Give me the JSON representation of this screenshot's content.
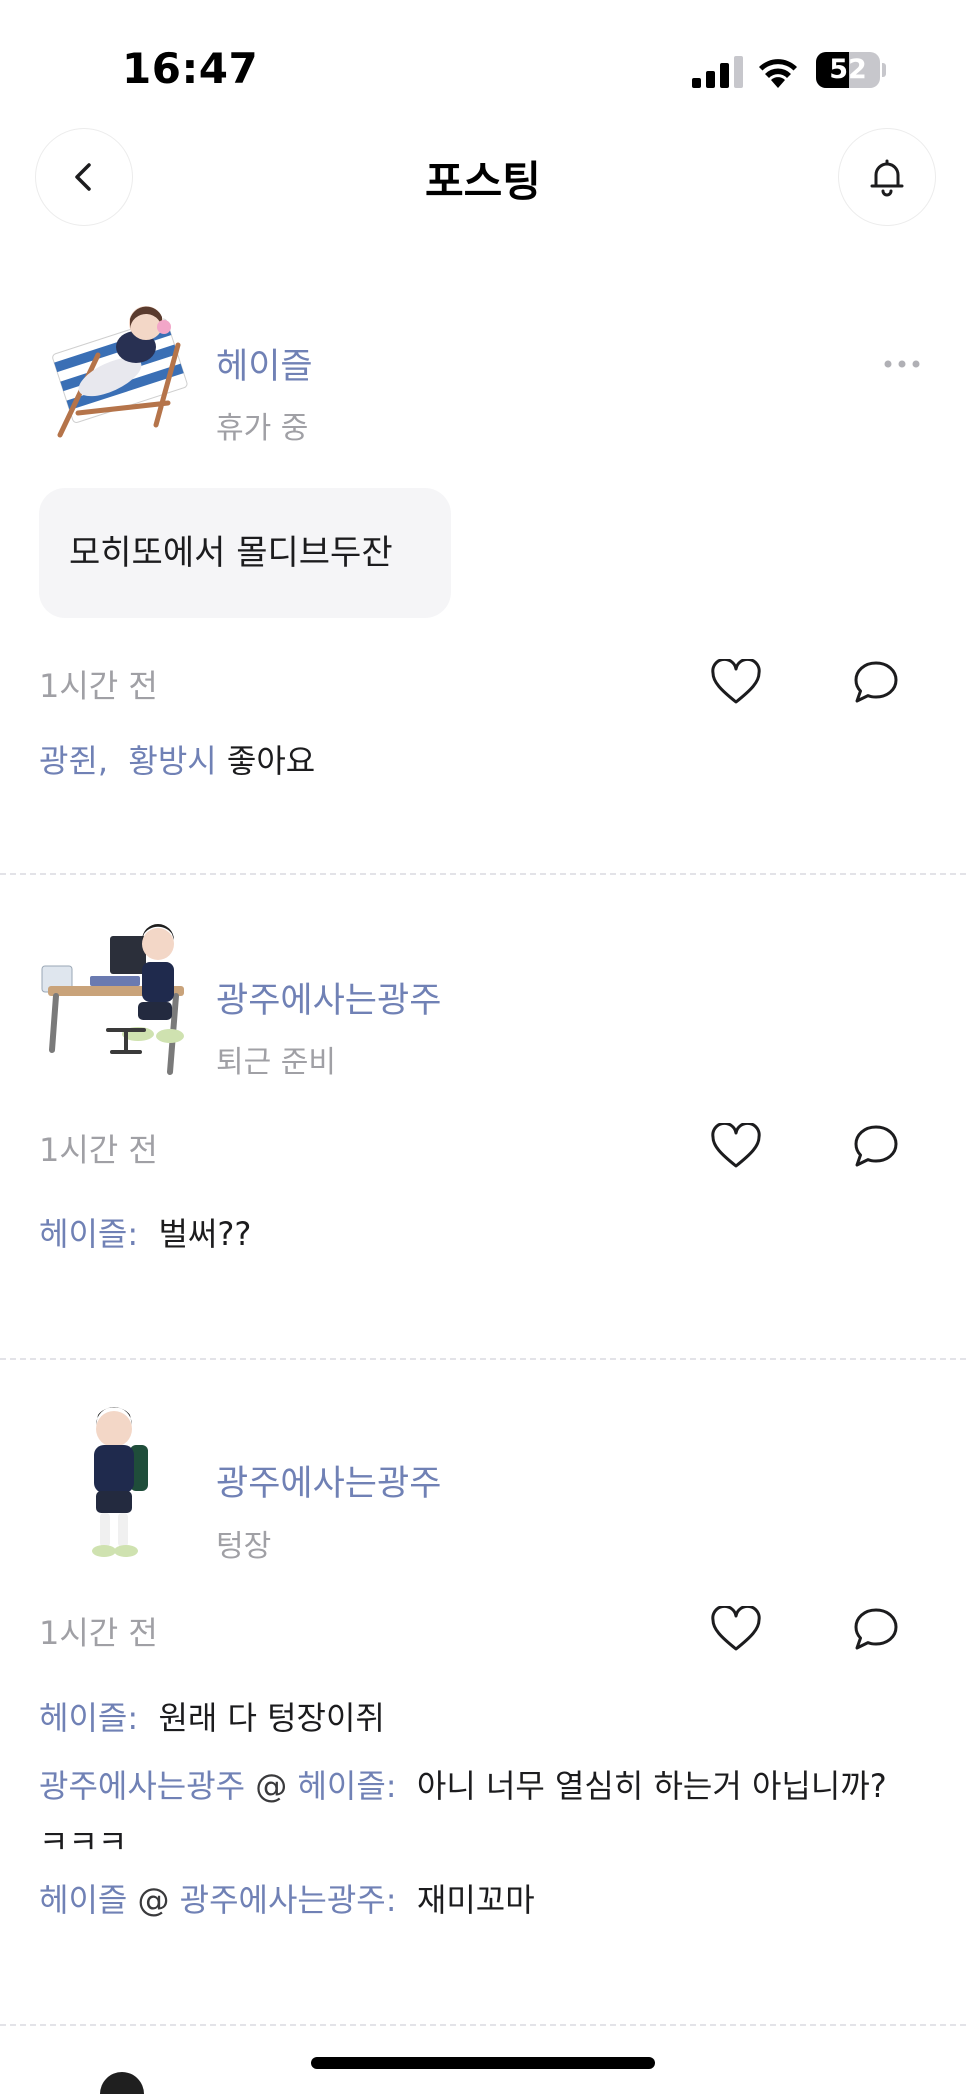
{
  "status_bar": {
    "time": "16:47",
    "battery": "52",
    "battery_level": 0.52
  },
  "header": {
    "title": "포스팅"
  },
  "posts": [
    {
      "author": "헤이즐",
      "status": "휴가 중",
      "content": "모히또에서 몰디브두잔",
      "time": "1시간 전",
      "likes": {
        "names": [
          "광쥔",
          "황방시"
        ],
        "separator": ",",
        "suffix": "좋아요"
      }
    },
    {
      "author": "광주에사는광주",
      "status": "퇴근 준비",
      "time": "1시간 전",
      "comments": [
        {
          "author": "헤이즐",
          "text": "벌써??"
        }
      ]
    },
    {
      "author": "광주에사는광주",
      "status": "텅장",
      "time": "1시간 전",
      "comments": [
        {
          "author": "헤이즐",
          "text": "원래 다 텅장이쥐"
        },
        {
          "author": "광주에사는광주",
          "mention": "헤이즐",
          "text": "아니 너무 열심히 하는거 아닙니까? ㅋㅋㅋ"
        },
        {
          "author": "헤이즐",
          "mention": "광주에사는광주",
          "text": "재미꼬마"
        }
      ]
    }
  ],
  "labels": {
    "colon": ":",
    "at": "@"
  },
  "colors": {
    "accent": "#7081b5",
    "muted": "#a0a0a5",
    "bubble": "#f5f5f7"
  },
  "icons": [
    "back-icon",
    "bell-icon",
    "more-icon",
    "heart-icon",
    "chat-icon"
  ]
}
